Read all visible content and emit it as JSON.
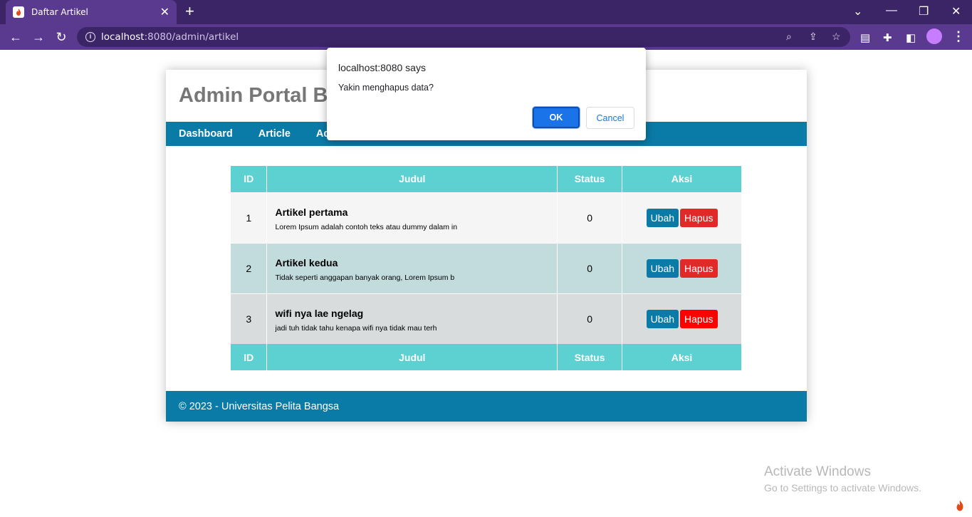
{
  "browser": {
    "tab_title": "Daftar Artikel",
    "tab_favicon": "codeigniter-flame-icon",
    "url_host": "localhost",
    "url_rest": ":8080/admin/artikel"
  },
  "site": {
    "title": "Admin Portal B",
    "nav": [
      "Dashboard",
      "Article",
      "Ad"
    ],
    "footer": "© 2023 - Universitas Pelita Bangsa"
  },
  "table": {
    "headers": [
      "ID",
      "Judul",
      "Status",
      "Aksi"
    ],
    "rows": [
      {
        "id": "1",
        "title": "Artikel pertama",
        "body": "Lorem Ipsum adalah contoh teks atau dummy dalam in",
        "status": "0",
        "edit": "Ubah",
        "delete": "Hapus"
      },
      {
        "id": "2",
        "title": "Artikel kedua",
        "body": "Tidak seperti anggapan banyak orang, Lorem Ipsum b",
        "status": "0",
        "edit": "Ubah",
        "delete": "Hapus"
      },
      {
        "id": "3",
        "title": "wifi nya lae ngelag",
        "body": "jadi tuh tidak tahu kenapa wifi nya tidak mau terh",
        "status": "0",
        "edit": "Ubah",
        "delete": "Hapus"
      }
    ]
  },
  "dialog": {
    "origin": "localhost:8080 says",
    "message": "Yakin menghapus data?",
    "ok_label": "OK",
    "cancel_label": "Cancel"
  },
  "watermark": {
    "line1": "Activate Windows",
    "line2": "Go to Settings to activate Windows."
  },
  "colors": {
    "chrome_frame": "#3c2566",
    "chrome_toolbar": "#5a3a8f",
    "nav_blue": "#0a7ba7",
    "table_header": "#5dd0d2",
    "delete_red": "#e02a2a",
    "dialog_ok": "#1a73e8"
  }
}
